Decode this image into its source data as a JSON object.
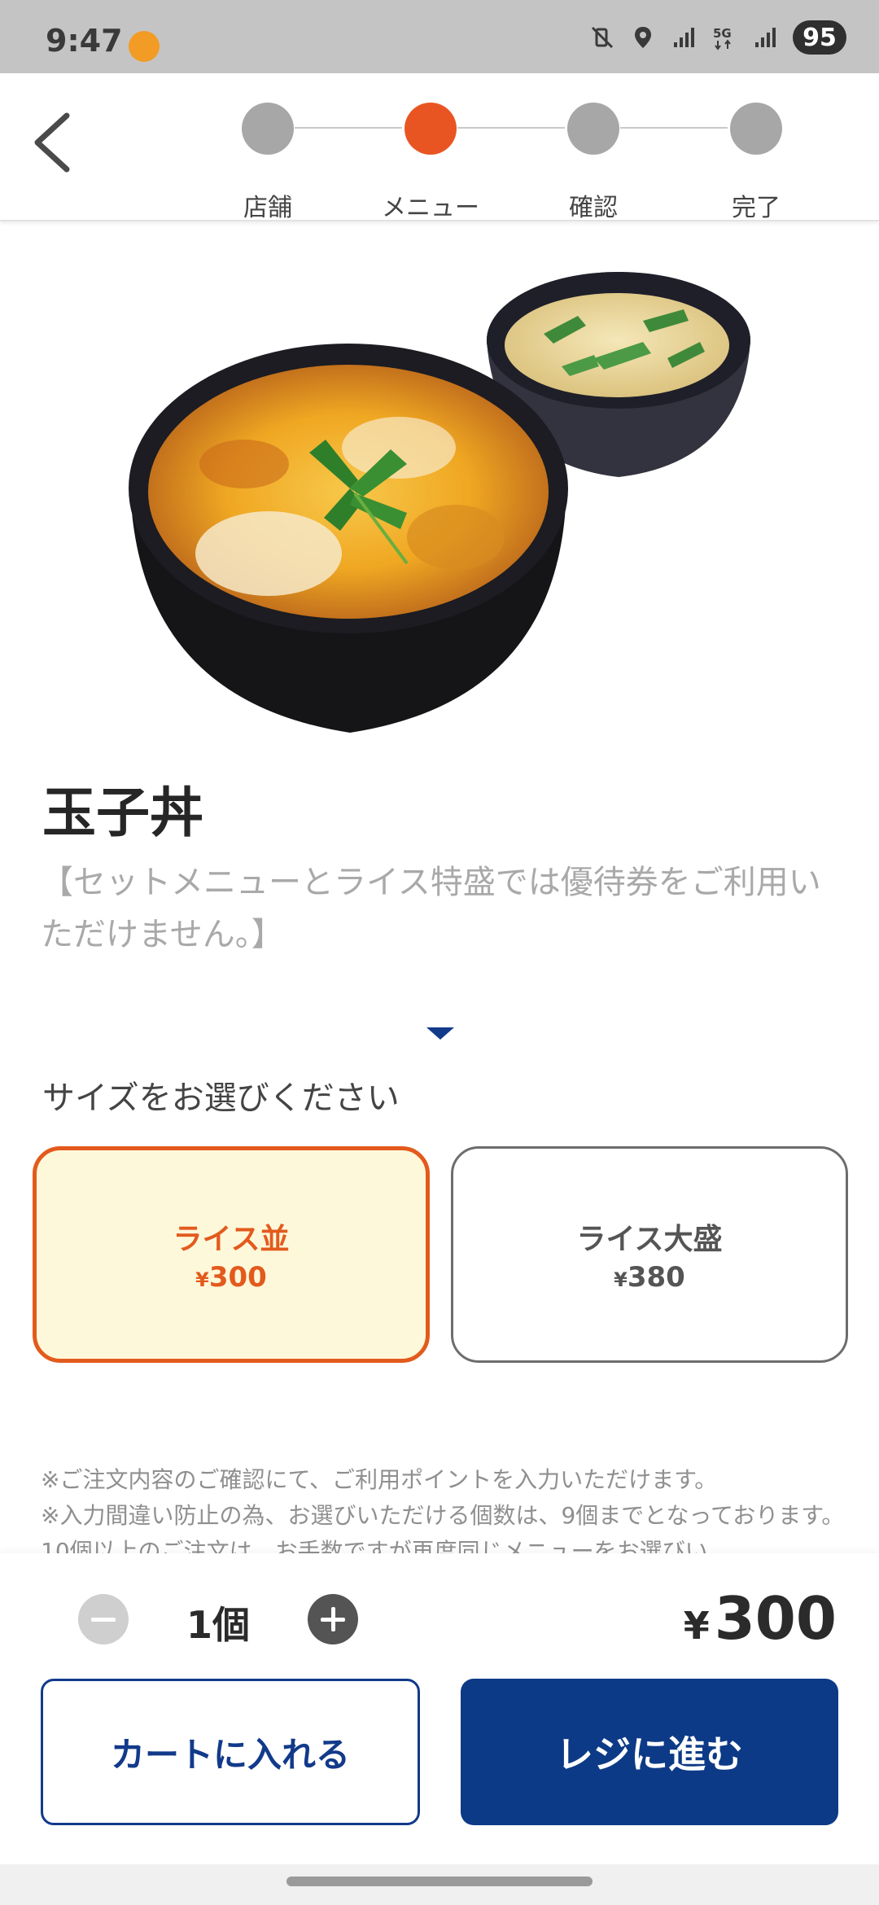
{
  "status_bar": {
    "time": "9:47",
    "network": "5G",
    "battery": "95",
    "icons": [
      "app-notification-icon",
      "mute-vibrate-icon",
      "location-icon",
      "signal-icon",
      "5g-icon",
      "signal-icon"
    ]
  },
  "stepper": {
    "steps": [
      "店舗",
      "メニュー",
      "確認",
      "完了"
    ],
    "active_index": 1,
    "active_color": "#e95522",
    "inactive_color": "#a7a7a7"
  },
  "product": {
    "name": "玉子丼",
    "description": "【セットメニューとライス特盛では優待券をご利用いただけません。】"
  },
  "size_section": {
    "prompt": "サイズをお選びください",
    "options": [
      {
        "label": "ライス並",
        "price_symbol": "¥",
        "price": "300",
        "selected": true
      },
      {
        "label": "ライス大盛",
        "price_symbol": "¥",
        "price": "380",
        "selected": false
      }
    ]
  },
  "notes": [
    "※ご注文内容のご確認にて、ご利用ポイントを入力いただけます。",
    "※入力間違い防止の為、お選びいただける個数は、9個までとなっております。10個以上のご注文は、お手数ですが再度同じメニューをお選びい"
  ],
  "order": {
    "quantity": "1個",
    "total_symbol": "¥",
    "total": "300"
  },
  "actions": {
    "add_to_cart": "カートに入れる",
    "checkout": "レジに進む"
  },
  "colors": {
    "brand_navy": "#0d3a86",
    "accent_orange": "#e35a1d",
    "selected_bg": "#fef8da"
  }
}
